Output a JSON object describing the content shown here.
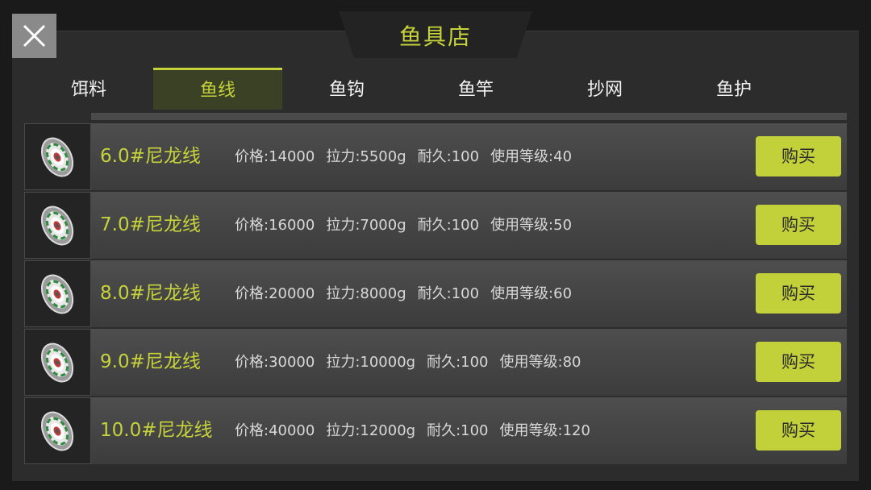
{
  "shop": {
    "title": "鱼具店"
  },
  "tabs": [
    {
      "label": "饵料",
      "active": false
    },
    {
      "label": "鱼线",
      "active": true
    },
    {
      "label": "鱼钩",
      "active": false
    },
    {
      "label": "鱼竿",
      "active": false
    },
    {
      "label": "抄网",
      "active": false
    },
    {
      "label": "鱼护",
      "active": false
    }
  ],
  "items": [
    {
      "icon": "fishing-line-spool-icon",
      "name": "6.0#尼龙线",
      "price": "价格:14000",
      "strength": "拉力:5500g",
      "durability": "耐久:100",
      "level": "使用等级:40",
      "buy_label": "购买"
    },
    {
      "icon": "fishing-line-spool-icon",
      "name": "7.0#尼龙线",
      "price": "价格:16000",
      "strength": "拉力:7000g",
      "durability": "耐久:100",
      "level": "使用等级:50",
      "buy_label": "购买"
    },
    {
      "icon": "fishing-line-spool-icon",
      "name": "8.0#尼龙线",
      "price": "价格:20000",
      "strength": "拉力:8000g",
      "durability": "耐久:100",
      "level": "使用等级:60",
      "buy_label": "购买"
    },
    {
      "icon": "fishing-line-spool-icon",
      "name": "9.0#尼龙线",
      "price": "价格:30000",
      "strength": "拉力:10000g",
      "durability": "耐久:100",
      "level": "使用等级:80",
      "buy_label": "购买"
    },
    {
      "icon": "fishing-line-spool-icon",
      "name": "10.0#尼龙线",
      "price": "价格:40000",
      "strength": "拉力:12000g",
      "durability": "耐久:100",
      "level": "使用等级:120",
      "buy_label": "购买"
    }
  ],
  "colors": {
    "accent": "#c6d33a",
    "button": "#c2d03a",
    "panel": "#2c2c2c"
  }
}
